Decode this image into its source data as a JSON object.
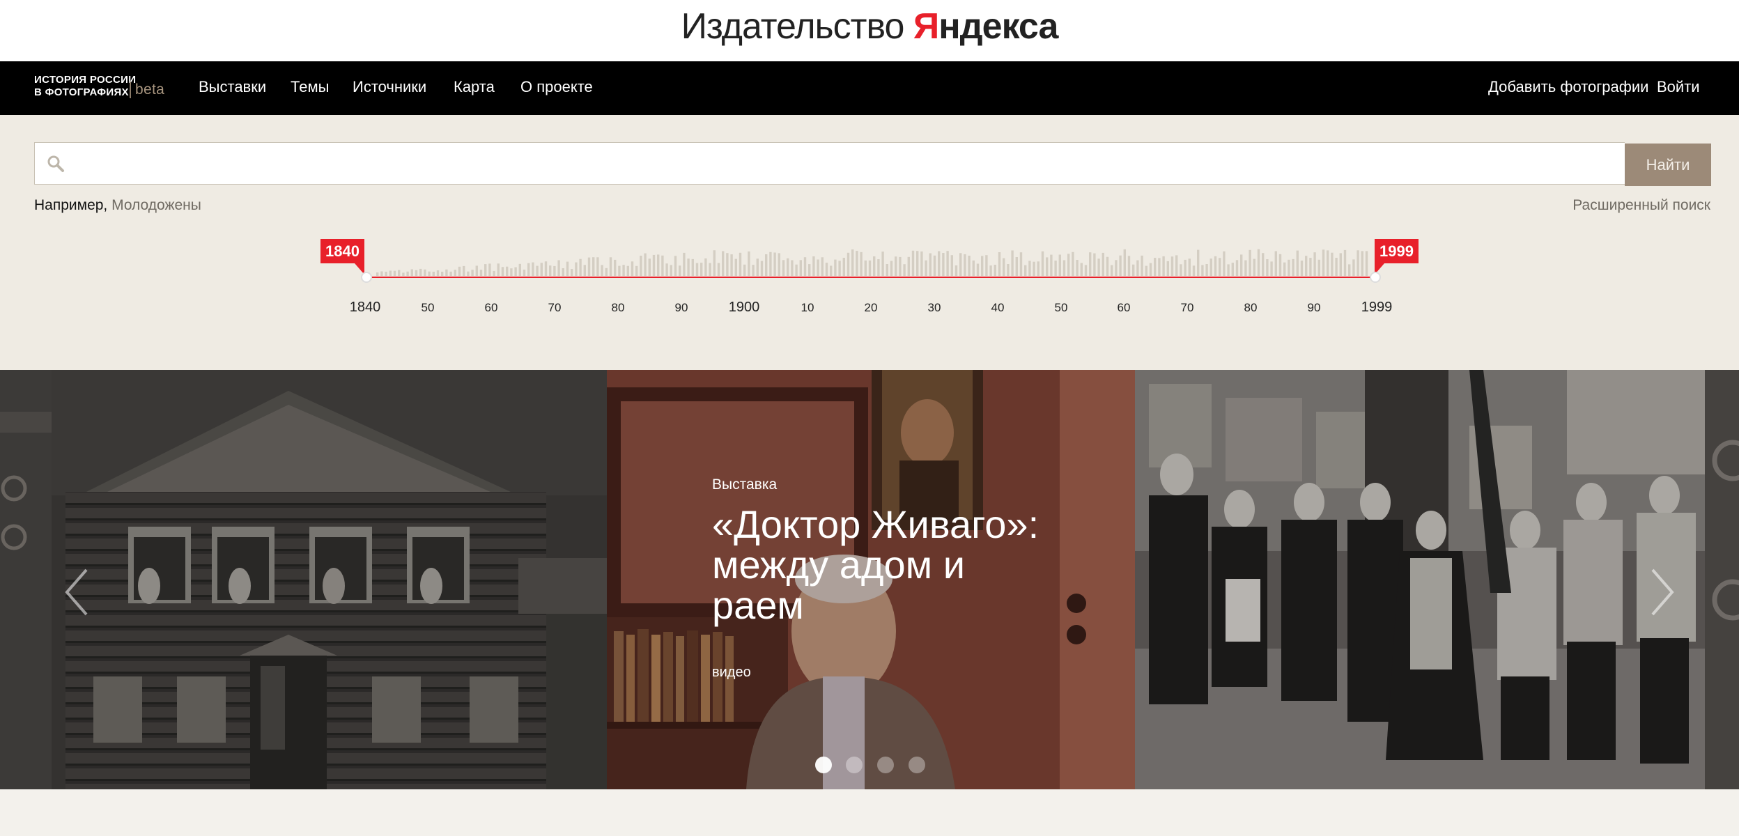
{
  "brand": {
    "prefix": "Издательство ",
    "ya": "Я",
    "ya_rest": "ндекса"
  },
  "nav": {
    "logo_line1": "ИСТОРИЯ РОССИИ",
    "logo_line2": "В ФОТОГРАФИЯХ",
    "logo_beta": "beta",
    "items": [
      "Выставки",
      "Темы",
      "Источники",
      "Карта",
      "О проекте"
    ],
    "add_photos": "Добавить фотографии",
    "login": "Войти"
  },
  "search": {
    "placeholder": "",
    "button": "Найти",
    "example_label": "Например,",
    "example_value": "Молодожены",
    "advanced": "Расширенный поиск"
  },
  "timeline": {
    "start_year": "1840",
    "end_year": "1999",
    "ticks": [
      "1840",
      "50",
      "60",
      "70",
      "80",
      "90",
      "1900",
      "10",
      "20",
      "30",
      "40",
      "50",
      "60",
      "70",
      "80",
      "90",
      "1999"
    ]
  },
  "slider": {
    "label": "Выставка",
    "title": "«Доктор Живаго»: между адом и раем",
    "meta": "видео",
    "dots_count": 4,
    "active_dot": 1
  },
  "colors": {
    "accent_red": "#e8202a",
    "button_brown": "#9c8a78",
    "page_bg": "#efebe3"
  }
}
